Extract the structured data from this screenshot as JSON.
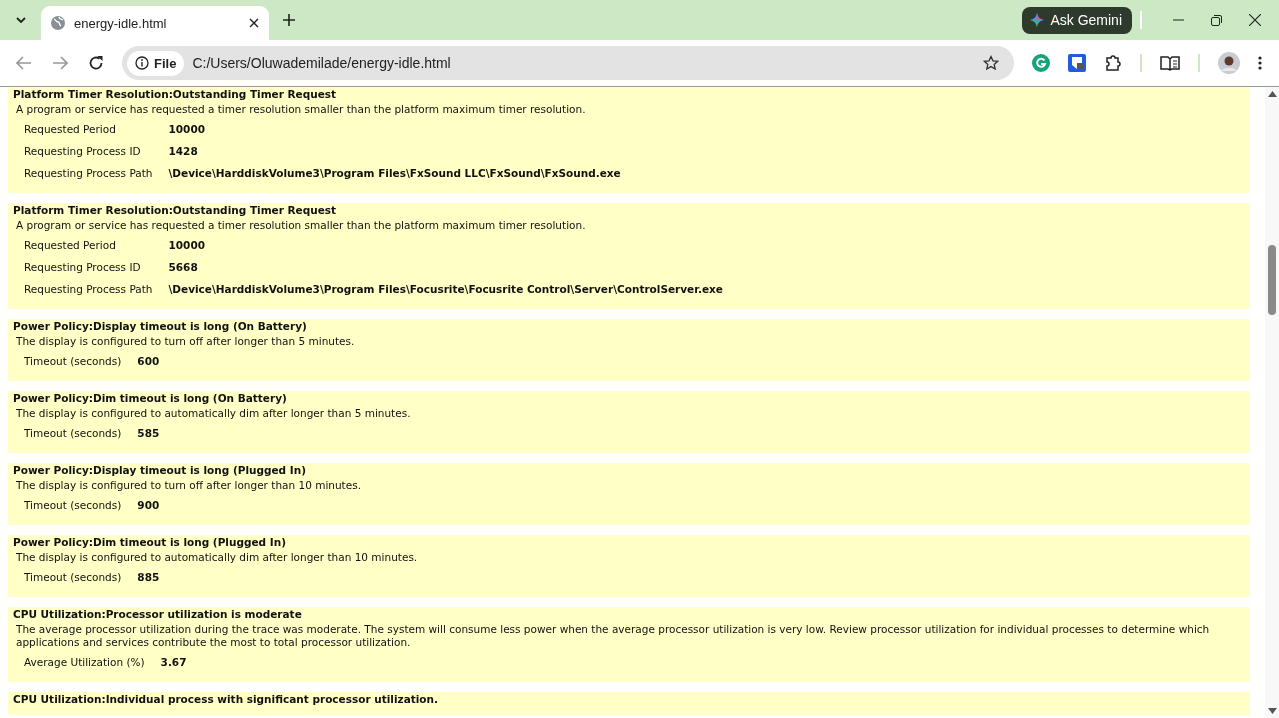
{
  "browser": {
    "tab_title": "energy-idle.html",
    "ask_button": "Ask Gemini",
    "site_chip": "File",
    "address": "C:/Users/Oluwademilade/energy-idle.html"
  },
  "entries": [
    {
      "title": "Platform Timer Resolution:Outstanding Timer Request",
      "description": "A program or service has requested a timer resolution smaller than the platform maximum timer resolution.",
      "fields": [
        {
          "label": "Requested Period",
          "value": "10000"
        },
        {
          "label": "Requesting Process ID",
          "value": "1428"
        },
        {
          "label": "Requesting Process Path",
          "value": "\\Device\\HarddiskVolume3\\Program Files\\FxSound LLC\\FxSound\\FxSound.exe"
        }
      ]
    },
    {
      "title": "Platform Timer Resolution:Outstanding Timer Request",
      "description": "A program or service has requested a timer resolution smaller than the platform maximum timer resolution.",
      "fields": [
        {
          "label": "Requested Period",
          "value": "10000"
        },
        {
          "label": "Requesting Process ID",
          "value": "5668"
        },
        {
          "label": "Requesting Process Path",
          "value": "\\Device\\HarddiskVolume3\\Program Files\\Focusrite\\Focusrite Control\\Server\\ControlServer.exe"
        }
      ]
    },
    {
      "title": "Power Policy:Display timeout is long (On Battery)",
      "description": "The display is configured to turn off after longer than 5 minutes.",
      "fields": [
        {
          "label": "Timeout (seconds)",
          "value": "600"
        }
      ]
    },
    {
      "title": "Power Policy:Dim timeout is long (On Battery)",
      "description": "The display is configured to automatically dim after longer than 5 minutes.",
      "fields": [
        {
          "label": "Timeout (seconds)",
          "value": "585"
        }
      ]
    },
    {
      "title": "Power Policy:Display timeout is long (Plugged In)",
      "description": "The display is configured to turn off after longer than 10 minutes.",
      "fields": [
        {
          "label": "Timeout (seconds)",
          "value": "900"
        }
      ]
    },
    {
      "title": "Power Policy:Dim timeout is long (Plugged In)",
      "description": "The display is configured to automatically dim after longer than 10 minutes.",
      "fields": [
        {
          "label": "Timeout (seconds)",
          "value": "885"
        }
      ]
    },
    {
      "title": "CPU Utilization:Processor utilization is moderate",
      "description": "The average processor utilization during the trace was moderate. The system will consume less power when the average processor utilization is very low. Review processor utilization for individual processes to determine which applications and services contribute the most to total processor utilization.",
      "fields": [
        {
          "label": "Average Utilization (%)",
          "value": "3.67"
        }
      ]
    },
    {
      "title": "CPU Utilization:Individual process with significant processor utilization."
    }
  ]
}
